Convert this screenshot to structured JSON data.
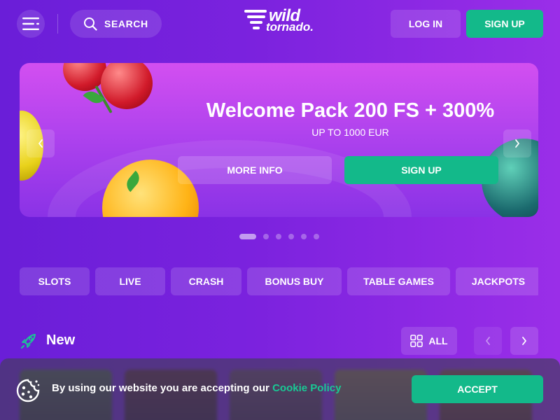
{
  "header": {
    "search_label": "SEARCH",
    "logo_line1": "wild",
    "logo_line2": "tornado.",
    "login_label": "LOG IN",
    "signup_label": "SIGN UP"
  },
  "banner": {
    "title": "Welcome Pack 200 FS + 300%",
    "subtitle": "UP TO 1000 EUR",
    "more_info_label": "MORE INFO",
    "signup_label": "SIGN UP",
    "slide_count": 6,
    "active_slide": 1
  },
  "categories": [
    "SLOTS",
    "LIVE",
    "CRASH",
    "BONUS BUY",
    "TABLE GAMES",
    "JACKPOTS"
  ],
  "section": {
    "title": "New",
    "all_label": "ALL"
  },
  "cookie": {
    "text": "By using our website you are accepting our ",
    "link_label": "Cookie Policy",
    "accept_label": "ACCEPT"
  },
  "colors": {
    "background": "#7b22de",
    "accent_green": "#13b98a",
    "link_green": "#19c894"
  },
  "icons": [
    "menu-icon",
    "search-icon",
    "chevron-left-icon",
    "chevron-right-icon",
    "rocket-icon",
    "grid-icon",
    "cookie-icon"
  ]
}
